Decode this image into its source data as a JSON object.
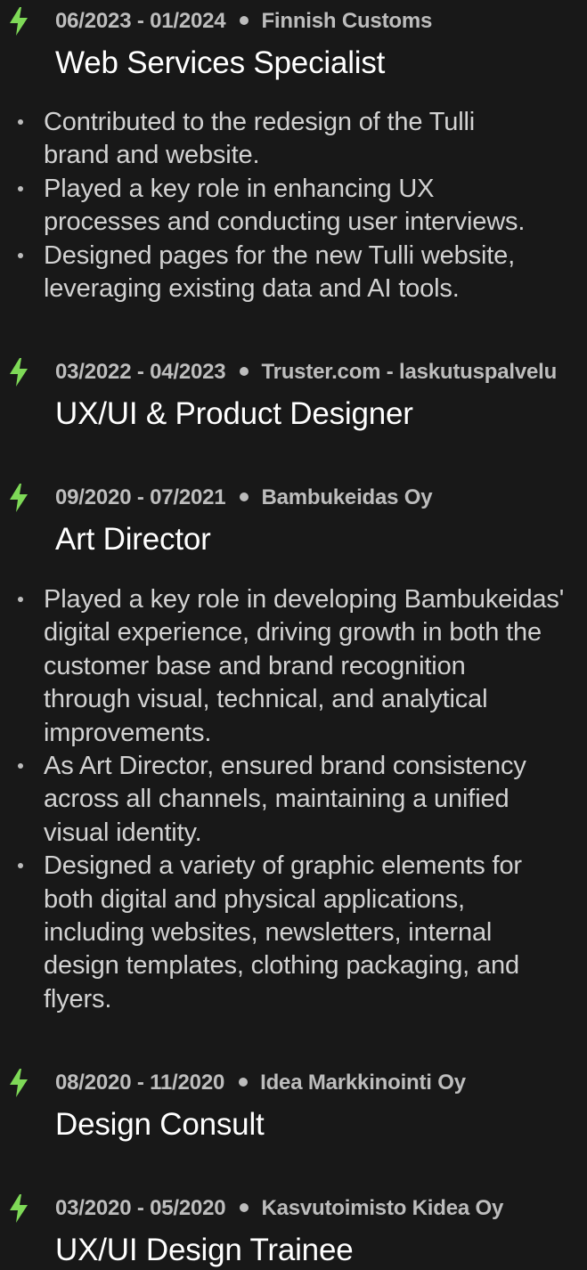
{
  "accent_color": "#7ed957",
  "icon": "lightning-bolt-icon",
  "experience": [
    {
      "dates": "06/2023 - 01/2024",
      "company": "Finnish Customs",
      "title": "Web Services Specialist",
      "bullets": [
        [
          "Contributed to the redesign of the Tulli",
          "brand and website."
        ],
        [
          "Played a key role in enhancing UX",
          "processes and conducting user interviews."
        ],
        [
          "Designed pages for the new Tulli website,",
          "leveraging existing data and AI tools."
        ]
      ]
    },
    {
      "dates": "03/2022 - 04/2023",
      "company": "Truster.com - laskutuspalvelu",
      "title": "UX/UI & Product Designer",
      "bullets": []
    },
    {
      "dates": "09/2020 - 07/2021",
      "company": "Bambukeidas Oy",
      "title": "Art Director",
      "bullets": [
        [
          "Played a key role in developing Bambukeidas'",
          "digital experience, driving growth in both the",
          "customer base and brand recognition",
          "through visual, technical, and analytical",
          "improvements."
        ],
        [
          "As Art Director, ensured brand consistency",
          "across all channels, maintaining a unified",
          "visual identity."
        ],
        [
          "Designed a variety of graphic elements for",
          "both digital and physical applications,",
          "including websites, newsletters, internal",
          "design templates, clothing packaging, and",
          "flyers."
        ]
      ]
    },
    {
      "dates": "08/2020 - 11/2020",
      "company": "Idea Markkinointi Oy",
      "title": "Design Consult",
      "bullets": []
    },
    {
      "dates": "03/2020 - 05/2020",
      "company": "Kasvutoimisto Kidea Oy",
      "title": "UX/UI Design Trainee",
      "bullets": []
    }
  ]
}
